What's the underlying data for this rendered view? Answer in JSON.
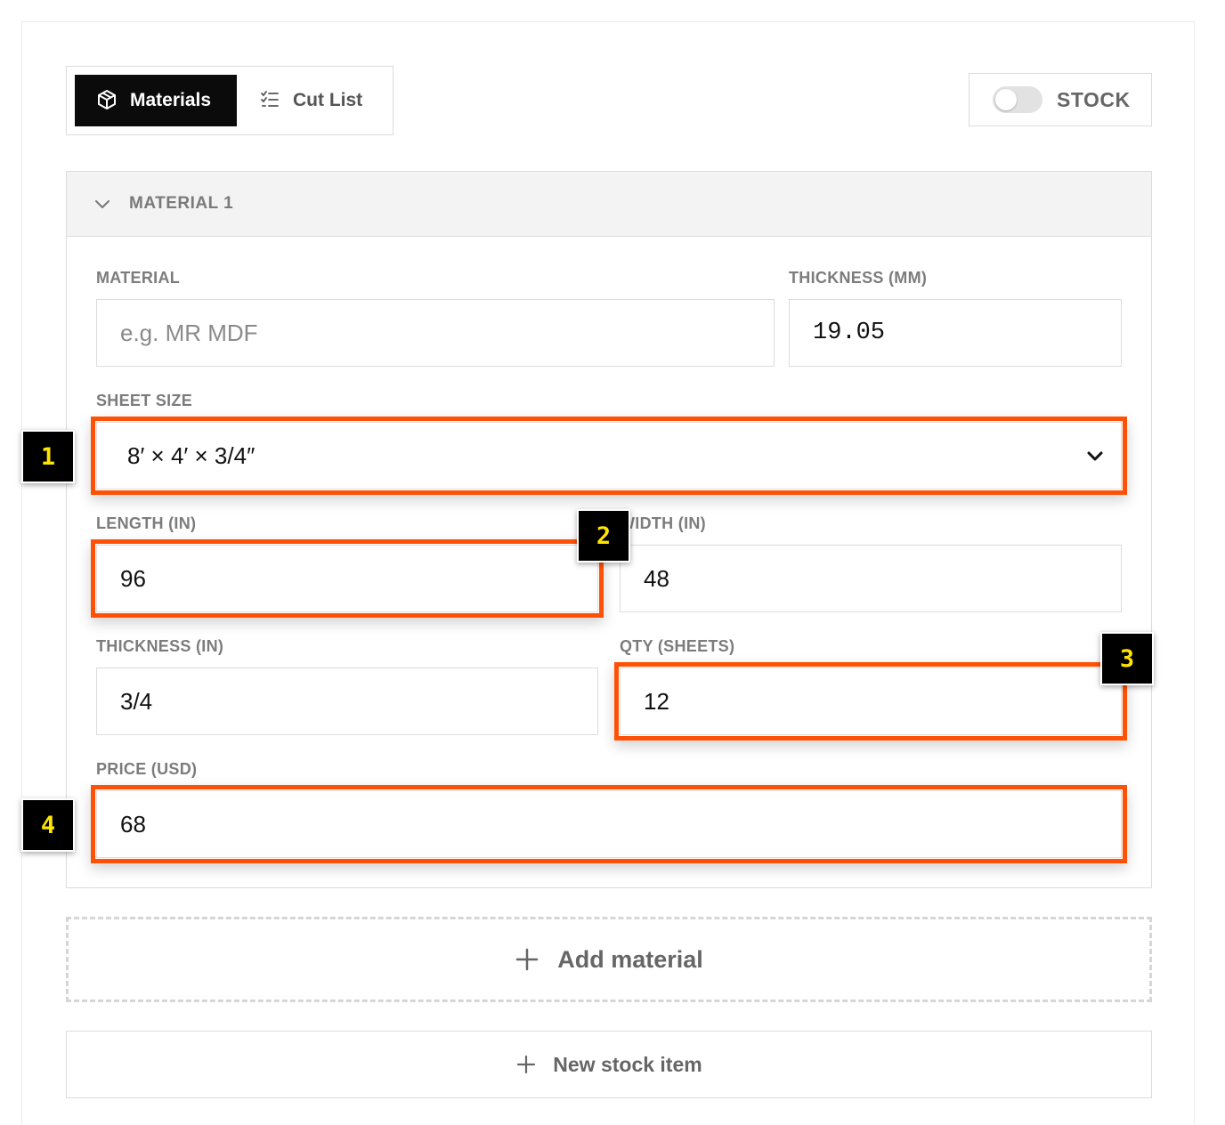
{
  "tabs": {
    "materials_label": "Materials",
    "cutlist_label": "Cut List"
  },
  "stock_toggle": {
    "label": "STOCK",
    "enabled": false
  },
  "material_card": {
    "title": "MATERIAL 1",
    "material": {
      "label": "MATERIAL",
      "placeholder": "e.g. MR MDF",
      "value": ""
    },
    "thickness_mm": {
      "label": "THICKNESS (MM)",
      "value": "19.05"
    },
    "sheet_size": {
      "label": "SHEET SIZE",
      "selected": "8′ × 4′ × 3/4″"
    },
    "length_in": {
      "label": "LENGTH (IN)",
      "value": "96"
    },
    "width_in": {
      "label": "WIDTH (IN)",
      "value": "48"
    },
    "thickness_in": {
      "label": "THICKNESS (IN)",
      "value": "3/4"
    },
    "qty_sheets": {
      "label": "QTY (SHEETS)",
      "value": "12"
    },
    "price_usd": {
      "label": "PRICE (USD)",
      "value": "68"
    }
  },
  "add_material_label": "Add material",
  "new_stock_label": "New stock item",
  "annotations": {
    "highlight_color": "#ff5106",
    "badges": [
      "1",
      "2",
      "3",
      "4"
    ]
  }
}
